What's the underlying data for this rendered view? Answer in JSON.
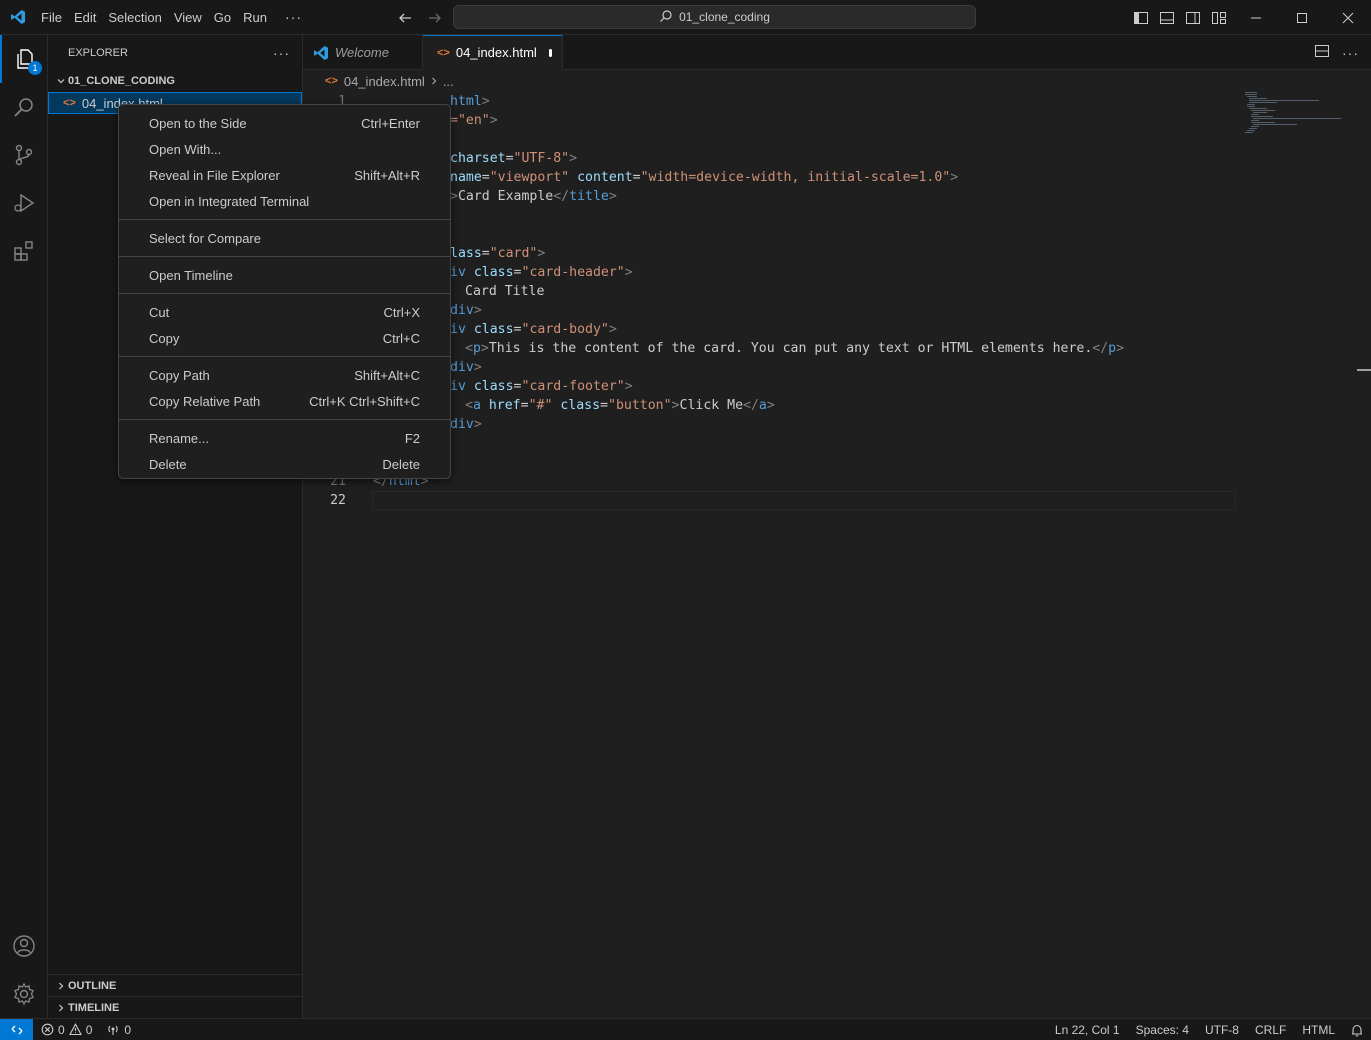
{
  "titlebar": {
    "menu": [
      "File",
      "Edit",
      "Selection",
      "View",
      "Go",
      "Run"
    ],
    "more": "···",
    "search": "01_clone_coding"
  },
  "sidebar": {
    "title": "EXPLORER",
    "more": "···",
    "folder": "01_CLONE_CODING",
    "file": "04_index.html",
    "outline": "OUTLINE",
    "timeline": "TIMELINE"
  },
  "activity": {
    "explorer_badge": "1"
  },
  "tabs": [
    {
      "label": "Welcome"
    },
    {
      "label": "04_index.html"
    }
  ],
  "breadcrumb": {
    "file": "04_index.html",
    "rest": "..."
  },
  "editor": {
    "line_numbers": [
      "1",
      "21",
      "22"
    ],
    "lines": {
      "l1b": "html",
      "l2": "=\"en\"",
      "l4a": "charset",
      "l4b": "\"UTF-8\"",
      "l5a": "name",
      "l5b": "\"viewport\"",
      "l5c": "content",
      "l5d": "\"width=device-width, initial-scale=1.0\"",
      "l6a": "Card Example",
      "l6b": "title",
      "l9a": "lass",
      "l9b": "\"card\"",
      "l10a": "iv",
      "l10b": "class",
      "l10c": "\"card-header\"",
      "l11": "Card Title",
      "l12": "div",
      "l13a": "iv",
      "l13b": "class",
      "l13c": "\"card-body\"",
      "l14a": "p",
      "l14b": "This is the content of the card. You can put any text or HTML elements here.",
      "l14c": "p",
      "l15": "div",
      "l16a": "iv",
      "l16b": "class",
      "l16c": "\"card-footer\"",
      "l17a": "a",
      "l17b": "href",
      "l17c": "\"#\"",
      "l17d": "class",
      "l17e": "\"button\"",
      "l17f": "Click Me",
      "l17g": "a",
      "l18": "div",
      "l21": "html"
    }
  },
  "context_menu": {
    "groups": [
      [
        {
          "label": "Open to the Side",
          "key": "Ctrl+Enter"
        },
        {
          "label": "Open With...",
          "key": ""
        },
        {
          "label": "Reveal in File Explorer",
          "key": "Shift+Alt+R"
        },
        {
          "label": "Open in Integrated Terminal",
          "key": ""
        }
      ],
      [
        {
          "label": "Select for Compare",
          "key": ""
        }
      ],
      [
        {
          "label": "Open Timeline",
          "key": ""
        }
      ],
      [
        {
          "label": "Cut",
          "key": "Ctrl+X"
        },
        {
          "label": "Copy",
          "key": "Ctrl+C"
        }
      ],
      [
        {
          "label": "Copy Path",
          "key": "Shift+Alt+C"
        },
        {
          "label": "Copy Relative Path",
          "key": "Ctrl+K Ctrl+Shift+C"
        }
      ],
      [
        {
          "label": "Rename...",
          "key": "F2"
        },
        {
          "label": "Delete",
          "key": "Delete"
        }
      ]
    ]
  },
  "statusbar": {
    "errors": "0",
    "warnings": "0",
    "ports": "0",
    "position": "Ln 22, Col 1",
    "spaces": "Spaces: 4",
    "encoding": "UTF-8",
    "eol": "CRLF",
    "language": "HTML"
  },
  "colors": {
    "accent": "#0078d4",
    "background": "#1f1f1f",
    "chrome": "#181818"
  }
}
